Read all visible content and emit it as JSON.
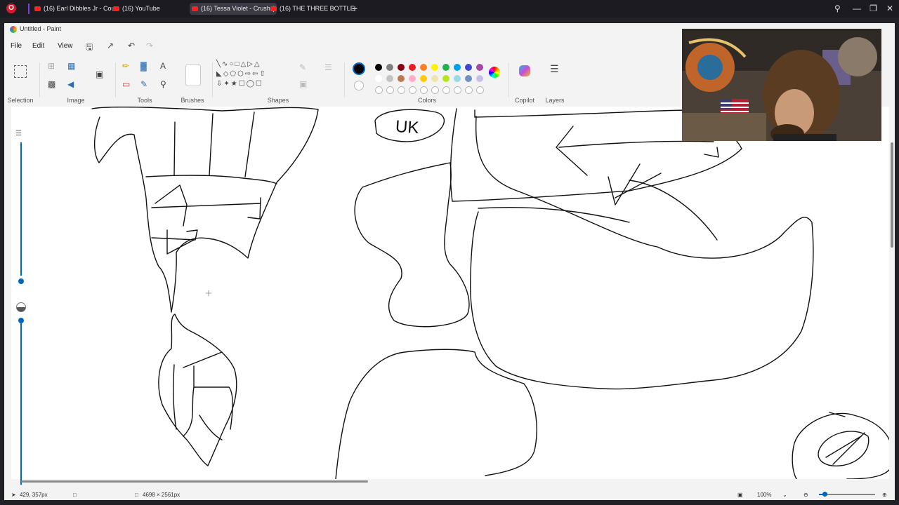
{
  "browser": {
    "tabs": [
      {
        "label": "(16) Earl Dibbles Jr - Coun",
        "active": false
      },
      {
        "label": "(16) YouTube",
        "active": false
      },
      {
        "label": "(16) Tessa Violet - Crush (",
        "active": true
      },
      {
        "label": "(16) THE THREE BOTTLE C",
        "active": false
      }
    ],
    "new_tab": "+"
  },
  "paint": {
    "title": "Untitled - Paint",
    "menu": [
      "File",
      "Edit",
      "View"
    ],
    "ribbon_groups": [
      "Selection",
      "Image",
      "Tools",
      "Brushes",
      "Shapes",
      "Colors",
      "Copilot",
      "Layers"
    ],
    "colors": {
      "active": "#000000",
      "row1": [
        "#000000",
        "#7f7f7f",
        "#880015",
        "#ed1c24",
        "#ff7f27",
        "#fff200",
        "#22b14c",
        "#00a2e8",
        "#3f48cc",
        "#a349a4"
      ],
      "row2": [
        "#ffffff",
        "#c3c3c3",
        "#b97a57",
        "#ffaec9",
        "#ffc90e",
        "#efe4b0",
        "#b5e61d",
        "#99d9ea",
        "#7092be",
        "#c8bfe7"
      ]
    },
    "status": {
      "cursor_pos": "429, 357px",
      "canvas_size": "4698 × 2561px",
      "zoom": "100%"
    },
    "canvas_text": "UK"
  }
}
